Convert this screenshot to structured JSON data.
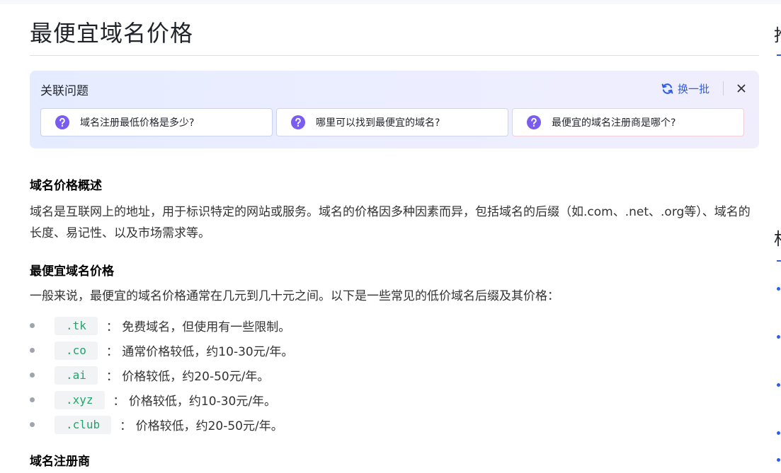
{
  "article": {
    "title": "最便宜域名价格",
    "related": {
      "heading": "关联问题",
      "refresh_label": "换一批",
      "questions": [
        "域名注册最低价格是多少?",
        "哪里可以找到最便宜的域名?",
        "最便宜的域名注册商是哪个?"
      ]
    },
    "sections": [
      {
        "heading": "域名价格概述",
        "body": "域名是互联网上的地址，用于标识特定的网站或服务。域名的价格因多种因素而异，包括域名的后缀（如.com、.net、.org等）、域名的长度、易记性、以及市场需求等。"
      },
      {
        "heading": "最便宜域名价格",
        "body": "一般来说，最便宜的域名价格通常在几元到几十元之间。以下是一些常见的低价域名后缀及其价格：",
        "items": [
          {
            "code": ".tk",
            "text": "： 免费域名，但使用有一些限制。"
          },
          {
            "code": ".co",
            "text": "： 通常价格较低，约10-30元/年。"
          },
          {
            "code": ".ai",
            "text": "： 价格较低，约20-50元/年。"
          },
          {
            "code": ".xyz",
            "text": "： 价格较低，约10-30元/年。"
          },
          {
            "code": ".club",
            "text": "： 价格较低，约20-50元/年。"
          }
        ]
      },
      {
        "heading": "域名注册商"
      }
    ]
  },
  "right_sidebar": {
    "fragment_1": "推",
    "fragment_2": "相"
  },
  "colors": {
    "accent_blue": "#2c5ee8",
    "code_green": "#21a56c",
    "question_icon_purple": "#7a5cf0"
  },
  "icons": {
    "refresh": "refresh-icon",
    "close": "close-icon",
    "question": "question-mark-icon"
  }
}
